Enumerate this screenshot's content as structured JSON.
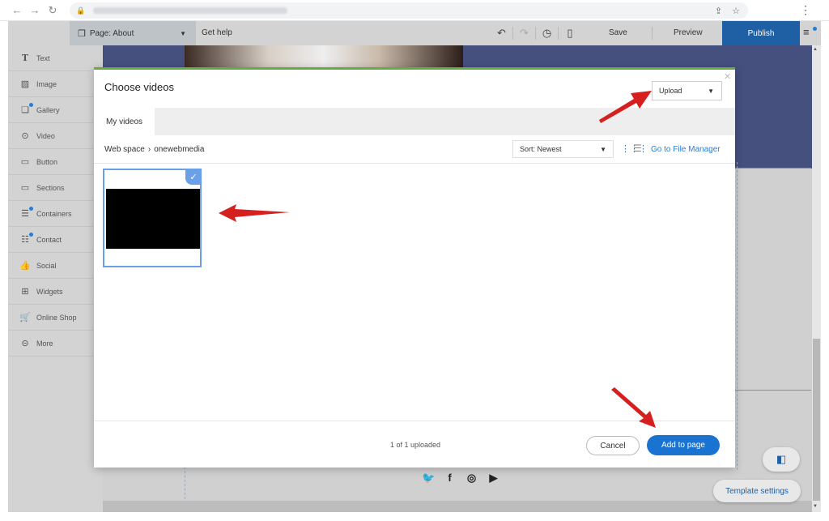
{
  "browser": {
    "back_icon": "arrow-left-icon",
    "forward_icon": "arrow-right-icon",
    "reload_icon": "reload-icon",
    "lock_icon": "lock-icon",
    "share_icon": "share-icon",
    "star_icon": "star-icon",
    "menu_icon": "kebab-icon"
  },
  "toolbar": {
    "page_label": "Page: About",
    "get_help": "Get help",
    "save": "Save",
    "preview": "Preview",
    "publish": "Publish",
    "publish_color": "#1f5fa4"
  },
  "sidebar": {
    "items": [
      {
        "label": "Text",
        "icon": "text-icon"
      },
      {
        "label": "Image",
        "icon": "image-icon"
      },
      {
        "label": "Gallery",
        "icon": "gallery-icon"
      },
      {
        "label": "Video",
        "icon": "video-icon"
      },
      {
        "label": "Button",
        "icon": "button-icon"
      },
      {
        "label": "Sections",
        "icon": "sections-icon"
      },
      {
        "label": "Containers",
        "icon": "containers-icon"
      },
      {
        "label": "Contact",
        "icon": "contact-icon"
      },
      {
        "label": "Social",
        "icon": "social-icon"
      },
      {
        "label": "Widgets",
        "icon": "widgets-icon"
      },
      {
        "label": "Online Shop",
        "icon": "cart-icon"
      },
      {
        "label": "More",
        "icon": "more-icon"
      }
    ]
  },
  "modal": {
    "title": "Choose videos",
    "upload_select": "Upload",
    "tab": "My videos",
    "breadcrumb_root": "Web space",
    "breadcrumb_folder": "onewebmedia",
    "sort_select": "Sort: Newest",
    "file_manager_link": "Go to File Manager",
    "status": "1 of 1 uploaded",
    "cancel": "Cancel",
    "add": "Add to page",
    "accent": "#6aa844",
    "button_color": "#1a73d1"
  },
  "template_settings": "Template settings"
}
